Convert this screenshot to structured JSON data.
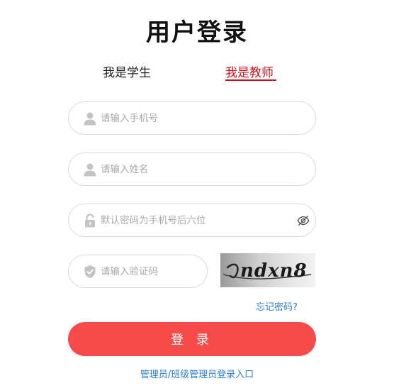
{
  "page": {
    "title": "用户登录"
  },
  "tabs": {
    "student": "我是学生",
    "teacher": "我是教师",
    "active": "teacher"
  },
  "form": {
    "phone_placeholder": "请输入手机号",
    "name_placeholder": "请输入姓名",
    "password_placeholder": "默认密码为手机号后六位",
    "captcha_placeholder": "请输入验证码",
    "captcha_image_text": "ndxn8",
    "forgot_password": "忘记密码?",
    "login_button": "登 录",
    "admin_login_link": "管理员/班级管理员登录入口"
  },
  "colors": {
    "accent_red": "#c8161d",
    "button_red": "#f74a4a",
    "link_blue": "#2f7fd0",
    "border": "#dcdcdc",
    "placeholder": "#a9a9a9"
  },
  "icons": {
    "phone_field": "user-icon",
    "name_field": "user-icon",
    "password_field": "lock-icon",
    "password_toggle": "eye-off-icon",
    "captcha_field": "shield-check-icon"
  }
}
